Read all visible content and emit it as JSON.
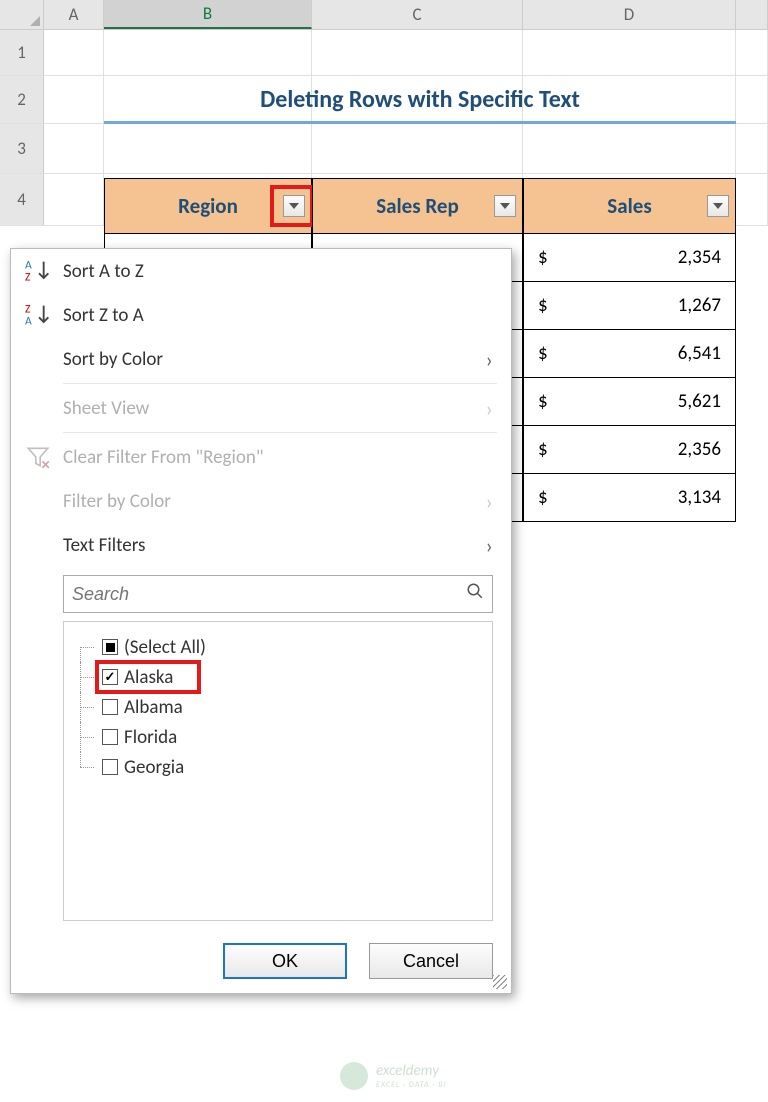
{
  "columns": {
    "a": "A",
    "b": "B",
    "c": "C",
    "d": "D"
  },
  "title": "Deleting Rows with Specific Text",
  "headers": {
    "region": "Region",
    "salesrep": "Sales Rep",
    "sales": "Sales"
  },
  "currency": "$",
  "rows": [
    {
      "idx": "1"
    },
    {
      "idx": "2"
    },
    {
      "idx": "3"
    },
    {
      "idx": "4"
    }
  ],
  "data_rows": [
    {
      "sales": "2,354"
    },
    {
      "sales": "1,267"
    },
    {
      "sales": "6,541"
    },
    {
      "sales": "5,621"
    },
    {
      "sales": "2,356"
    },
    {
      "sales": "3,134"
    }
  ],
  "menu": {
    "sort_az": "Sort A to Z",
    "sort_za": "Sort Z to A",
    "sort_color": "Sort by Color",
    "sheet_view": "Sheet View",
    "clear_filter": "Clear Filter From \"Region\"",
    "filter_color": "Filter by Color",
    "text_filters": "Text Filters",
    "search_placeholder": "Search",
    "items": [
      {
        "label": "(Select All)",
        "state": "square"
      },
      {
        "label": "Alaska",
        "state": "checked",
        "highlight": true
      },
      {
        "label": "Albama",
        "state": "unchecked"
      },
      {
        "label": "Florida",
        "state": "unchecked"
      },
      {
        "label": "Georgia",
        "state": "unchecked"
      }
    ],
    "ok": "OK",
    "cancel": "Cancel"
  },
  "watermark": {
    "brand": "exceldemy",
    "sub": "EXCEL · DATA · BI"
  }
}
